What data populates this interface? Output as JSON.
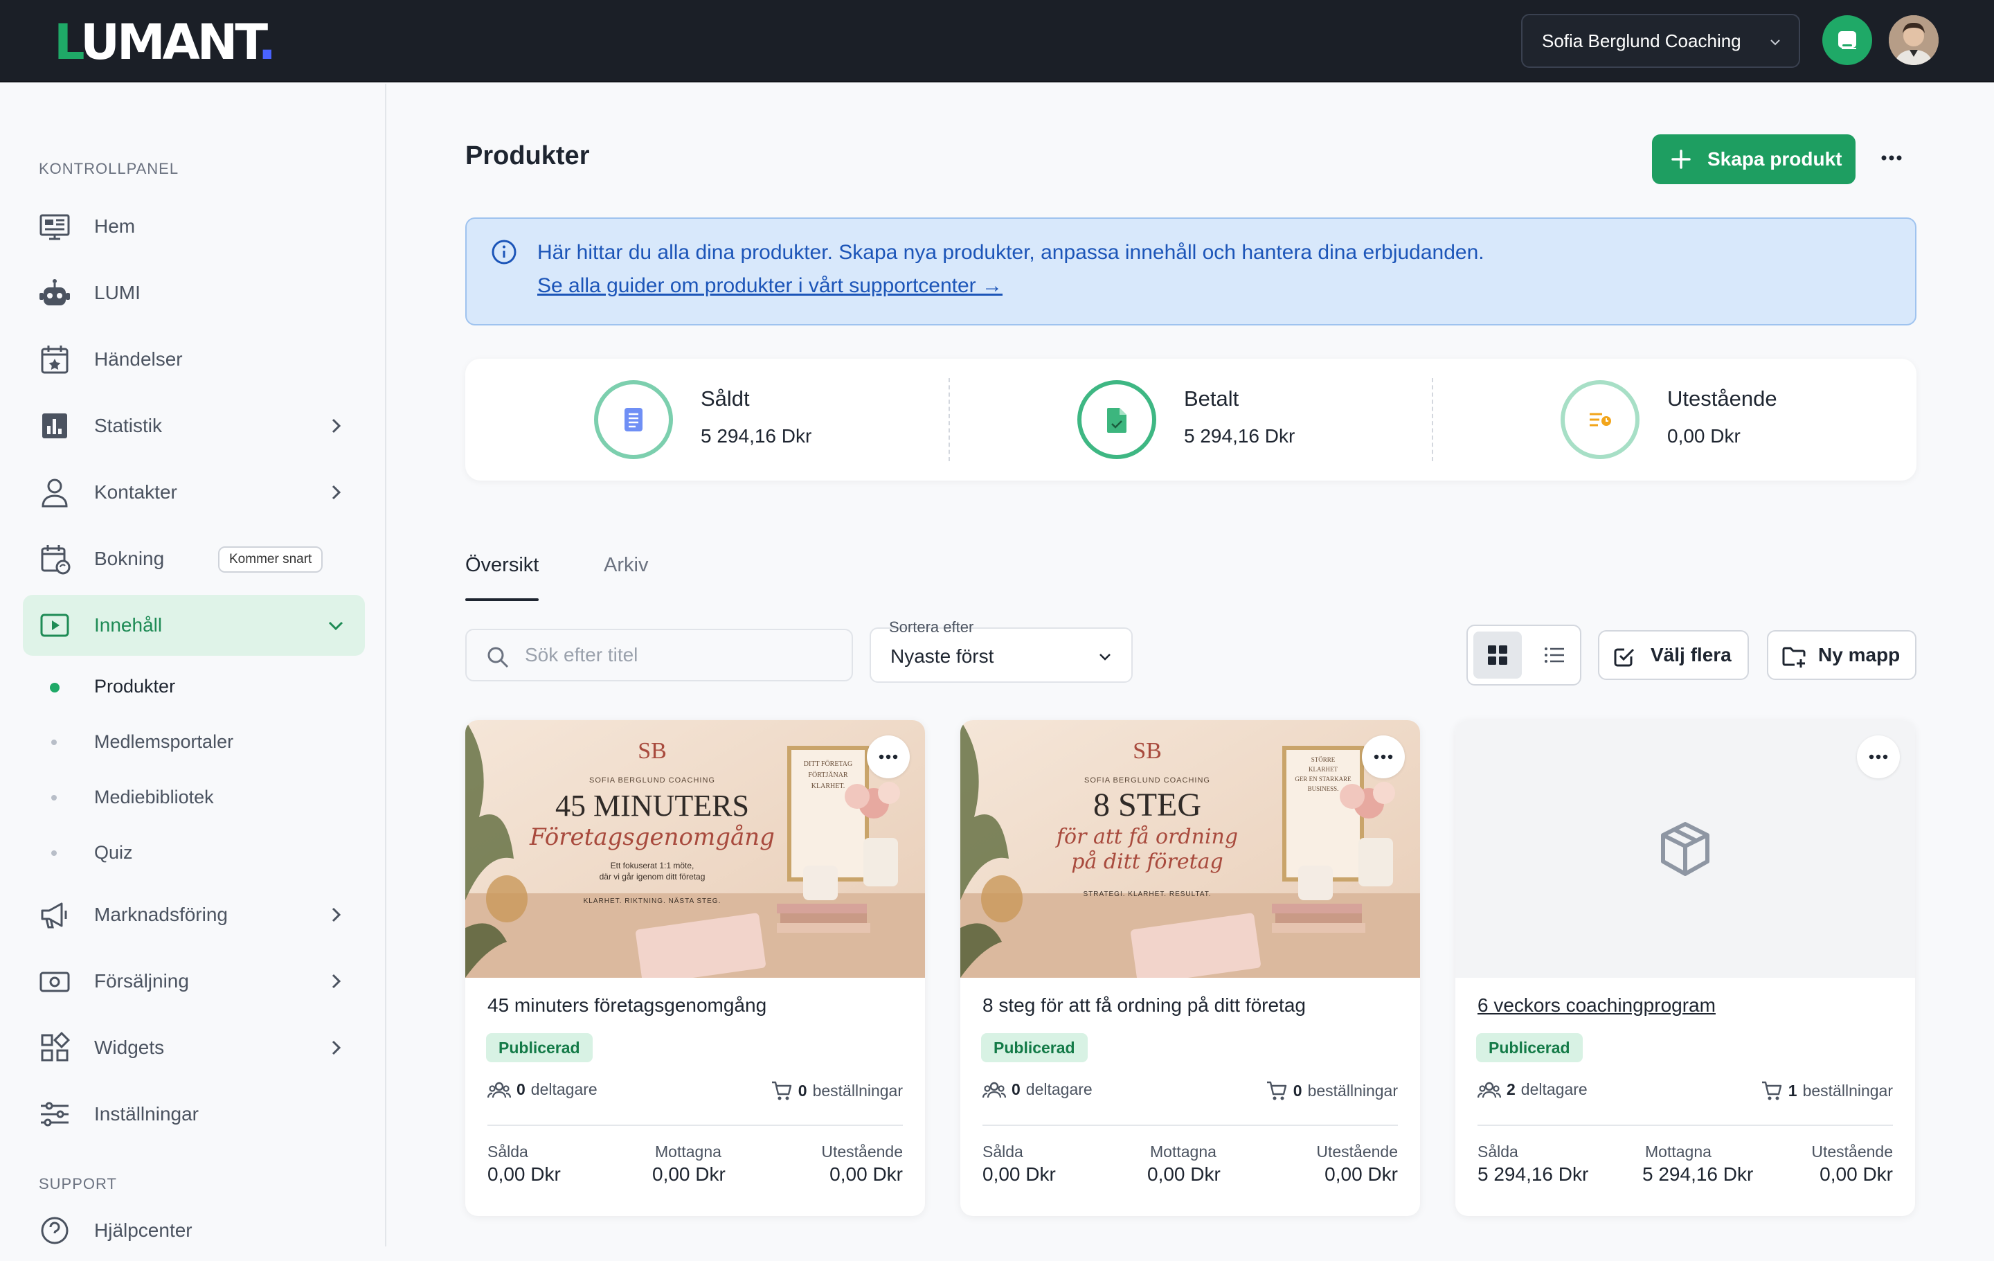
{
  "brand": {
    "logo": "LUMANT",
    "logo_dot": ".",
    "accent": "#1fa967"
  },
  "header": {
    "account_name": "Sofia Berglund Coaching"
  },
  "sidebar": {
    "section_main": "KONTROLLPANEL",
    "section_support": "SUPPORT",
    "items": [
      {
        "label": "Hem",
        "icon": "dashboard-icon"
      },
      {
        "label": "LUMI",
        "icon": "robot-icon"
      },
      {
        "label": "Händelser",
        "icon": "calendar-star-icon"
      },
      {
        "label": "Statistik",
        "icon": "chart-icon"
      },
      {
        "label": "Kontakter",
        "icon": "person-icon"
      },
      {
        "label": "Bokning",
        "icon": "calendar-sync-icon",
        "badge": "Kommer snart"
      },
      {
        "label": "Innehåll",
        "icon": "play-icon"
      },
      {
        "label": "Marknadsföring",
        "icon": "megaphone-icon"
      },
      {
        "label": "Försäljning",
        "icon": "money-icon"
      },
      {
        "label": "Widgets",
        "icon": "widgets-icon"
      },
      {
        "label": "Inställningar",
        "icon": "sliders-icon"
      },
      {
        "label": "Hjälpcenter",
        "icon": "help-icon"
      }
    ],
    "sub_items": [
      "Produkter",
      "Medlemsportaler",
      "Mediebibliotek",
      "Quiz"
    ]
  },
  "main": {
    "title": "Produkter",
    "create_label": "Skapa produkt",
    "info_text": "Här hittar du alla dina produkter. Skapa nya produkter, anpassa innehåll och hantera dina erbjudanden.",
    "info_link": "Se alla guider om produkter i vårt supportcenter →",
    "stats": [
      {
        "label": "Såldt",
        "value": "5 294,16 Dkr"
      },
      {
        "label": "Betalt",
        "value": "5 294,16 Dkr"
      },
      {
        "label": "Utestående",
        "value": "0,00 Dkr"
      }
    ],
    "tabs": [
      "Översikt",
      "Arkiv"
    ],
    "search_placeholder": "Sök efter titel",
    "sort_label": "Sortera efter",
    "sort_value": "Nyaste först",
    "select_many": "Välj flera",
    "new_folder": "Ny mapp"
  },
  "cards": [
    {
      "title": "45 minuters företagsgenomgång",
      "status": "Publicerad",
      "participants": "0",
      "participants_label": "deltagare",
      "orders": "0",
      "orders_label": "beställningar",
      "sold_label": "Sålda",
      "sold": "0,00 Dkr",
      "received_label": "Mottagna",
      "received": "0,00 Dkr",
      "outstanding_label": "Utestående",
      "outstanding": "0,00 Dkr",
      "thumb": {
        "monogram": "SB",
        "brand": "SOFIA BERGLUND COACHING",
        "headline": "45 MINUTERS",
        "script": "Företagsgenomgång",
        "sub1": "Ett fokuserat 1:1 möte,",
        "sub2": "där vi går igenom ditt företag",
        "tag": "KLARHET. RIKTNING. NÄSTA STEG.",
        "frame1": "DITT FÖRETAG",
        "frame2": "FÖRTJÄNAR",
        "frame3": "KLARHET."
      }
    },
    {
      "title": "8 steg för att få ordning på ditt företag",
      "status": "Publicerad",
      "participants": "0",
      "participants_label": "deltagare",
      "orders": "0",
      "orders_label": "beställningar",
      "sold_label": "Sålda",
      "sold": "0,00 Dkr",
      "received_label": "Mottagna",
      "received": "0,00 Dkr",
      "outstanding_label": "Utestående",
      "outstanding": "0,00 Dkr",
      "thumb": {
        "monogram": "SB",
        "brand": "SOFIA BERGLUND COACHING",
        "headline": "8 STEG",
        "script": "för att få ordning",
        "script2": "på ditt företag",
        "tag": "STRATEGI. KLARHET. RESULTAT.",
        "frame1": "STÖRRE",
        "frame2": "KLARHET",
        "frame3": "GER EN STARKARE",
        "frame4": "BUSINESS."
      }
    },
    {
      "title": "6 veckors coachingprogram",
      "status": "Publicerad",
      "participants": "2",
      "participants_label": "deltagare",
      "orders": "1",
      "orders_label": "beställningar",
      "sold_label": "Sålda",
      "sold": "5 294,16 Dkr",
      "received_label": "Mottagna",
      "received": "5 294,16 Dkr",
      "outstanding_label": "Utestående",
      "outstanding": "0,00 Dkr",
      "thumb": {
        "icon": "box-icon"
      }
    }
  ]
}
